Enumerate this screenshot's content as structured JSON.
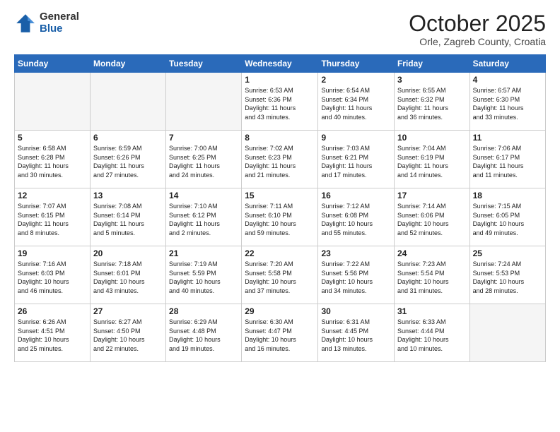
{
  "logo": {
    "general": "General",
    "blue": "Blue"
  },
  "title": "October 2025",
  "subtitle": "Orle, Zagreb County, Croatia",
  "weekdays": [
    "Sunday",
    "Monday",
    "Tuesday",
    "Wednesday",
    "Thursday",
    "Friday",
    "Saturday"
  ],
  "weeks": [
    [
      {
        "day": "",
        "info": ""
      },
      {
        "day": "",
        "info": ""
      },
      {
        "day": "",
        "info": ""
      },
      {
        "day": "1",
        "info": "Sunrise: 6:53 AM\nSunset: 6:36 PM\nDaylight: 11 hours\nand 43 minutes."
      },
      {
        "day": "2",
        "info": "Sunrise: 6:54 AM\nSunset: 6:34 PM\nDaylight: 11 hours\nand 40 minutes."
      },
      {
        "day": "3",
        "info": "Sunrise: 6:55 AM\nSunset: 6:32 PM\nDaylight: 11 hours\nand 36 minutes."
      },
      {
        "day": "4",
        "info": "Sunrise: 6:57 AM\nSunset: 6:30 PM\nDaylight: 11 hours\nand 33 minutes."
      }
    ],
    [
      {
        "day": "5",
        "info": "Sunrise: 6:58 AM\nSunset: 6:28 PM\nDaylight: 11 hours\nand 30 minutes."
      },
      {
        "day": "6",
        "info": "Sunrise: 6:59 AM\nSunset: 6:26 PM\nDaylight: 11 hours\nand 27 minutes."
      },
      {
        "day": "7",
        "info": "Sunrise: 7:00 AM\nSunset: 6:25 PM\nDaylight: 11 hours\nand 24 minutes."
      },
      {
        "day": "8",
        "info": "Sunrise: 7:02 AM\nSunset: 6:23 PM\nDaylight: 11 hours\nand 21 minutes."
      },
      {
        "day": "9",
        "info": "Sunrise: 7:03 AM\nSunset: 6:21 PM\nDaylight: 11 hours\nand 17 minutes."
      },
      {
        "day": "10",
        "info": "Sunrise: 7:04 AM\nSunset: 6:19 PM\nDaylight: 11 hours\nand 14 minutes."
      },
      {
        "day": "11",
        "info": "Sunrise: 7:06 AM\nSunset: 6:17 PM\nDaylight: 11 hours\nand 11 minutes."
      }
    ],
    [
      {
        "day": "12",
        "info": "Sunrise: 7:07 AM\nSunset: 6:15 PM\nDaylight: 11 hours\nand 8 minutes."
      },
      {
        "day": "13",
        "info": "Sunrise: 7:08 AM\nSunset: 6:14 PM\nDaylight: 11 hours\nand 5 minutes."
      },
      {
        "day": "14",
        "info": "Sunrise: 7:10 AM\nSunset: 6:12 PM\nDaylight: 11 hours\nand 2 minutes."
      },
      {
        "day": "15",
        "info": "Sunrise: 7:11 AM\nSunset: 6:10 PM\nDaylight: 10 hours\nand 59 minutes."
      },
      {
        "day": "16",
        "info": "Sunrise: 7:12 AM\nSunset: 6:08 PM\nDaylight: 10 hours\nand 55 minutes."
      },
      {
        "day": "17",
        "info": "Sunrise: 7:14 AM\nSunset: 6:06 PM\nDaylight: 10 hours\nand 52 minutes."
      },
      {
        "day": "18",
        "info": "Sunrise: 7:15 AM\nSunset: 6:05 PM\nDaylight: 10 hours\nand 49 minutes."
      }
    ],
    [
      {
        "day": "19",
        "info": "Sunrise: 7:16 AM\nSunset: 6:03 PM\nDaylight: 10 hours\nand 46 minutes."
      },
      {
        "day": "20",
        "info": "Sunrise: 7:18 AM\nSunset: 6:01 PM\nDaylight: 10 hours\nand 43 minutes."
      },
      {
        "day": "21",
        "info": "Sunrise: 7:19 AM\nSunset: 5:59 PM\nDaylight: 10 hours\nand 40 minutes."
      },
      {
        "day": "22",
        "info": "Sunrise: 7:20 AM\nSunset: 5:58 PM\nDaylight: 10 hours\nand 37 minutes."
      },
      {
        "day": "23",
        "info": "Sunrise: 7:22 AM\nSunset: 5:56 PM\nDaylight: 10 hours\nand 34 minutes."
      },
      {
        "day": "24",
        "info": "Sunrise: 7:23 AM\nSunset: 5:54 PM\nDaylight: 10 hours\nand 31 minutes."
      },
      {
        "day": "25",
        "info": "Sunrise: 7:24 AM\nSunset: 5:53 PM\nDaylight: 10 hours\nand 28 minutes."
      }
    ],
    [
      {
        "day": "26",
        "info": "Sunrise: 6:26 AM\nSunset: 4:51 PM\nDaylight: 10 hours\nand 25 minutes."
      },
      {
        "day": "27",
        "info": "Sunrise: 6:27 AM\nSunset: 4:50 PM\nDaylight: 10 hours\nand 22 minutes."
      },
      {
        "day": "28",
        "info": "Sunrise: 6:29 AM\nSunset: 4:48 PM\nDaylight: 10 hours\nand 19 minutes."
      },
      {
        "day": "29",
        "info": "Sunrise: 6:30 AM\nSunset: 4:47 PM\nDaylight: 10 hours\nand 16 minutes."
      },
      {
        "day": "30",
        "info": "Sunrise: 6:31 AM\nSunset: 4:45 PM\nDaylight: 10 hours\nand 13 minutes."
      },
      {
        "day": "31",
        "info": "Sunrise: 6:33 AM\nSunset: 4:44 PM\nDaylight: 10 hours\nand 10 minutes."
      },
      {
        "day": "",
        "info": ""
      }
    ]
  ]
}
